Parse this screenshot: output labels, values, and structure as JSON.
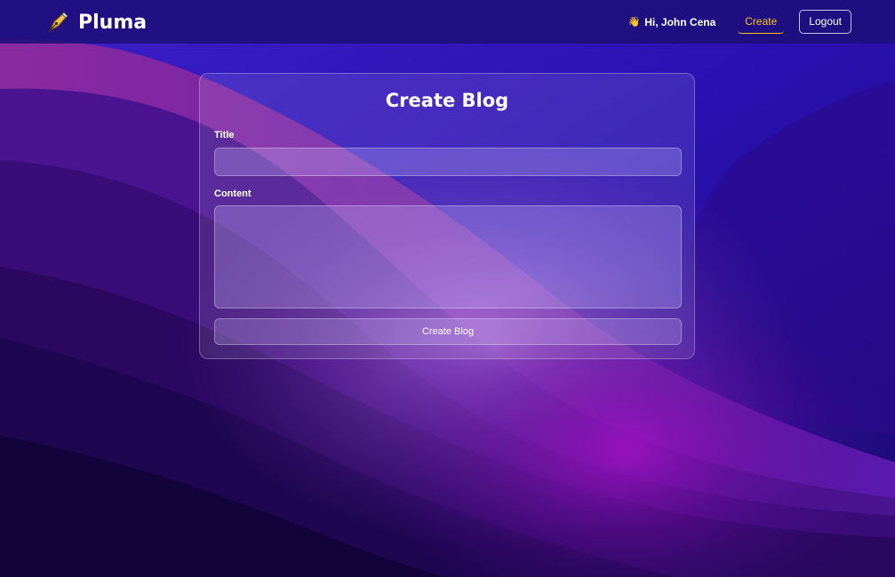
{
  "navbar": {
    "brand": "Pluma",
    "brand_icon": "fountain-pen-icon",
    "greeting_icon": "waving-hand-icon",
    "greeting": "Hi, John Cena",
    "create_link": "Create",
    "logout_button": "Logout"
  },
  "form": {
    "heading": "Create Blog",
    "title_label": "Title",
    "title_value": "",
    "content_label": "Content",
    "content_value": "",
    "submit_label": "Create Blog"
  },
  "colors": {
    "accent": "#f5c518",
    "navbar_bg": "#1c0e78",
    "bg_dark": "#140838"
  }
}
